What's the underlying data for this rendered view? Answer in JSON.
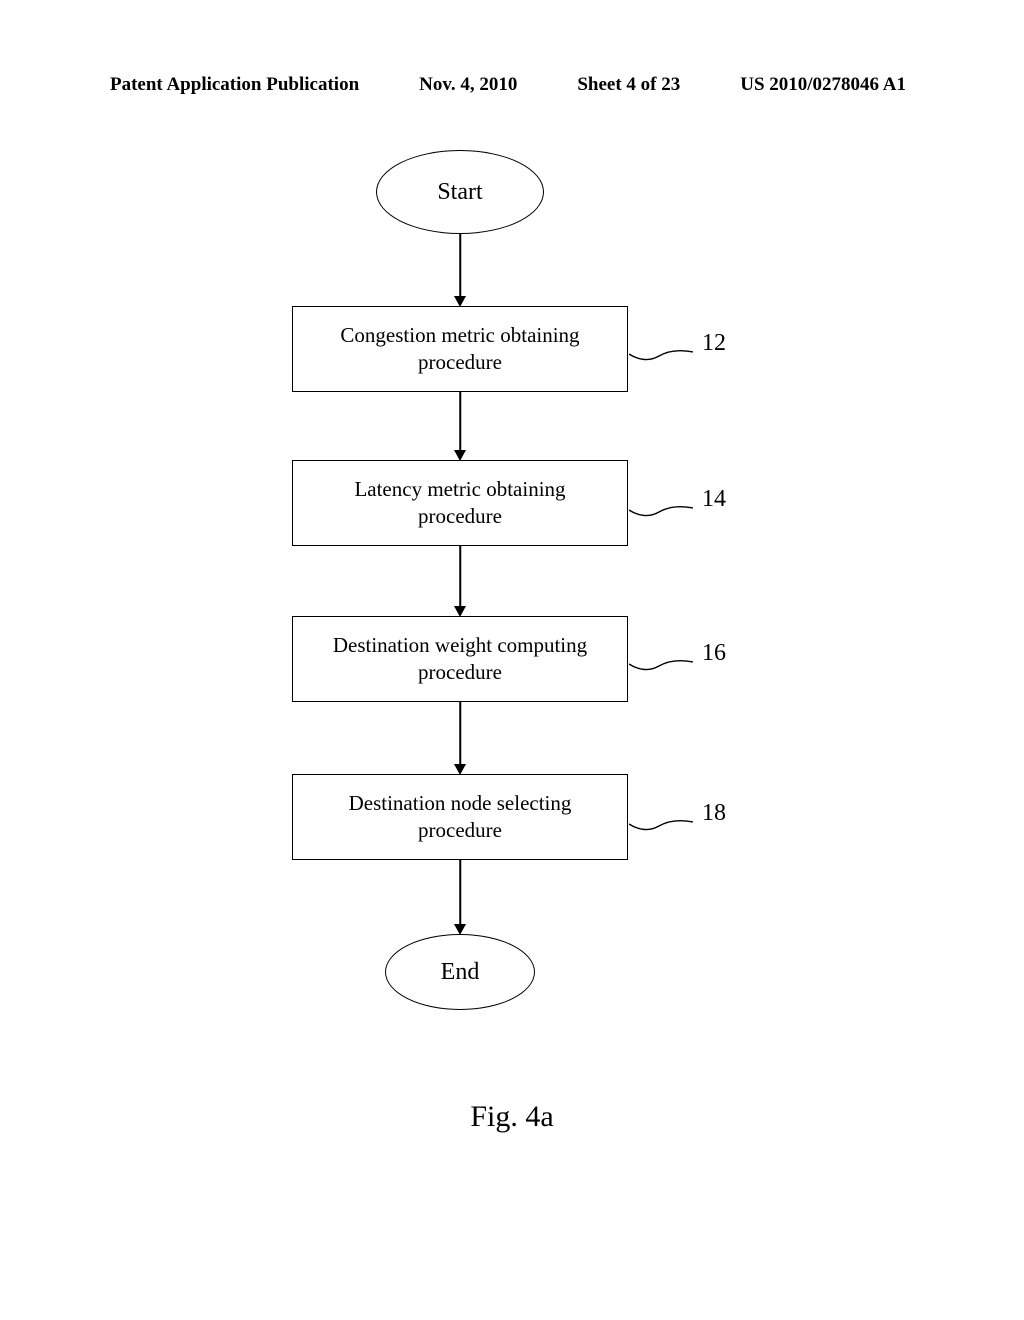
{
  "header": {
    "pub_type": "Patent Application Publication",
    "date": "Nov. 4, 2010",
    "sheet": "Sheet 4 of 23",
    "pub_no": "US 2010/0278046 A1"
  },
  "flow": {
    "start": "Start",
    "end": "End",
    "steps": [
      {
        "ref": "12",
        "text": "Congestion metric obtaining procedure"
      },
      {
        "ref": "14",
        "text": "Latency metric obtaining procedure"
      },
      {
        "ref": "16",
        "text": "Destination weight computing procedure"
      },
      {
        "ref": "18",
        "text": "Destination node selecting procedure"
      }
    ]
  },
  "caption": "Fig. 4a",
  "chart_data": {
    "type": "flowchart",
    "title": "Fig. 4a",
    "nodes": [
      {
        "id": "start",
        "shape": "terminal",
        "label": "Start"
      },
      {
        "id": "12",
        "shape": "process",
        "label": "Congestion metric obtaining procedure",
        "ref": "12"
      },
      {
        "id": "14",
        "shape": "process",
        "label": "Latency metric obtaining procedure",
        "ref": "14"
      },
      {
        "id": "16",
        "shape": "process",
        "label": "Destination weight computing procedure",
        "ref": "16"
      },
      {
        "id": "18",
        "shape": "process",
        "label": "Destination node selecting procedure",
        "ref": "18"
      },
      {
        "id": "end",
        "shape": "terminal",
        "label": "End"
      }
    ],
    "edges": [
      [
        "start",
        "12"
      ],
      [
        "12",
        "14"
      ],
      [
        "14",
        "16"
      ],
      [
        "16",
        "18"
      ],
      [
        "18",
        "end"
      ]
    ]
  }
}
